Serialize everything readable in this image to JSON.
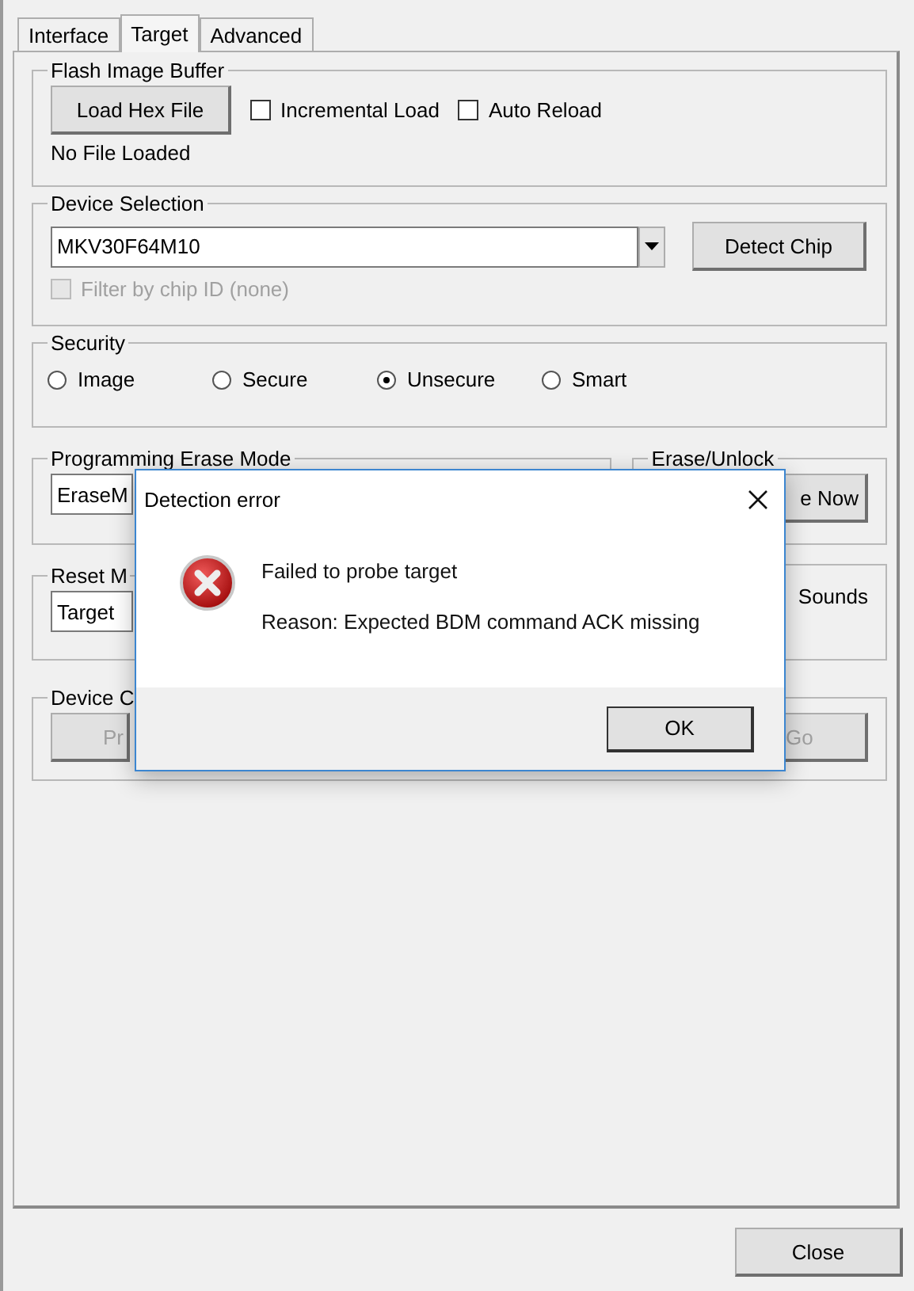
{
  "tabs": [
    {
      "label": "Interface",
      "selected": false
    },
    {
      "label": "Target",
      "selected": true
    },
    {
      "label": "Advanced",
      "selected": false
    }
  ],
  "flash_image_buffer": {
    "title": "Flash Image Buffer",
    "load_button": "Load Hex File",
    "options": [
      {
        "label": "Incremental Load",
        "checked": false
      },
      {
        "label": "Auto Reload",
        "checked": false
      }
    ],
    "status": "No File Loaded"
  },
  "device_selection": {
    "title": "Device Selection",
    "device": "MKV30F64M10",
    "detect_button": "Detect Chip",
    "filter": {
      "label": "Filter by chip ID (none)",
      "checked": false,
      "disabled": true
    }
  },
  "security": {
    "title": "Security",
    "options": [
      {
        "label": "Image",
        "selected": false
      },
      {
        "label": "Secure",
        "selected": false
      },
      {
        "label": "Unsecure",
        "selected": true
      },
      {
        "label": "Smart",
        "selected": false
      }
    ]
  },
  "erase_mode": {
    "title": "Programming Erase Mode",
    "value": "EraseM"
  },
  "erase_unlock": {
    "title": "Erase/Unlock",
    "button": "e Now"
  },
  "reset": {
    "title": "Reset M",
    "value": "Target"
  },
  "sounds": {
    "label": "Sounds"
  },
  "device_control": {
    "title": "Device C",
    "left_button": {
      "label": "Pr",
      "disabled": true
    },
    "right_button": {
      "label": "Go",
      "disabled": true
    }
  },
  "dialog": {
    "title": "Detection error",
    "message": "Failed to probe target",
    "detail": "Reason: Expected BDM command ACK missing",
    "ok_button": "OK"
  },
  "close_button": "Close"
}
